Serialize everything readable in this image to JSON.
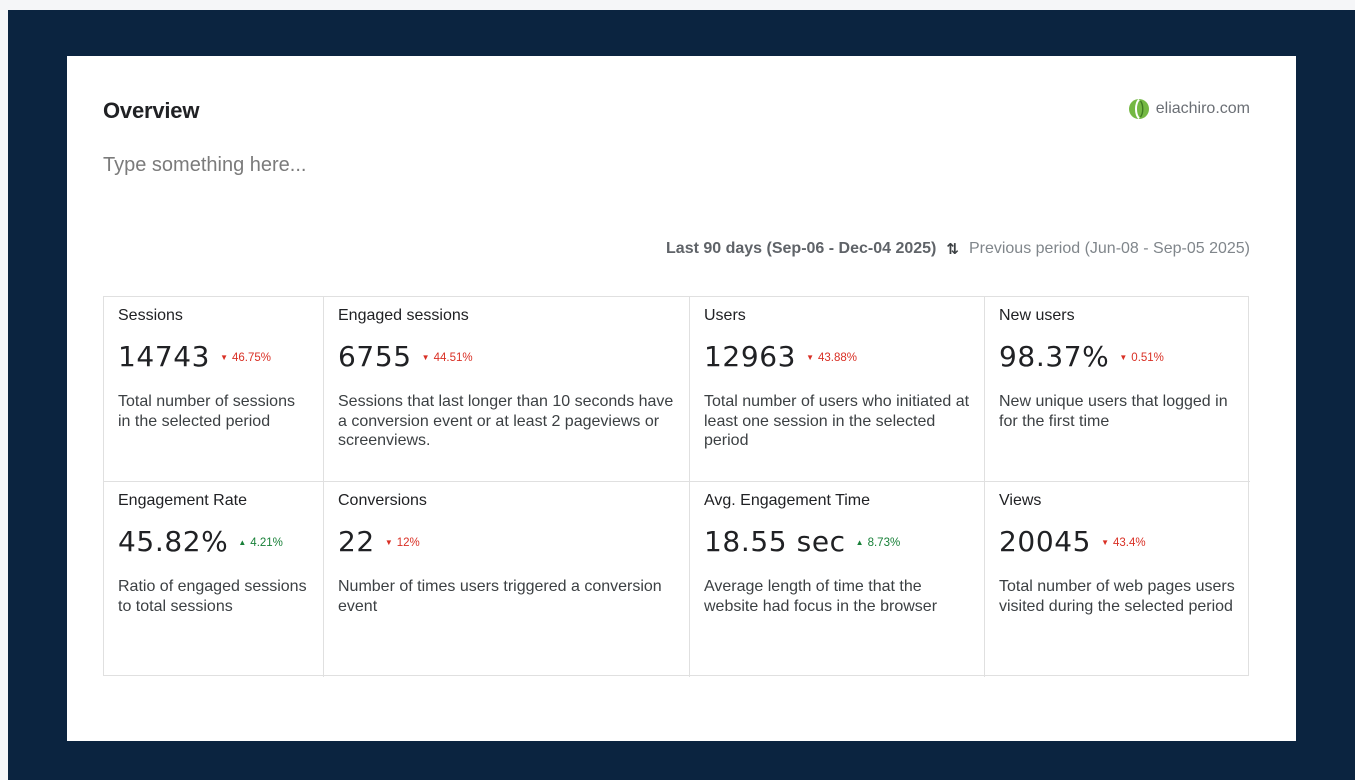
{
  "report": {
    "title": "Overview",
    "brand": "eliachiro.com",
    "description_placeholder": "Type something here...",
    "period_current": "Last 90 days (Sep-06 - Dec-04 2025)",
    "period_compare": "Previous period (Jun-08 - Sep-05 2025)"
  },
  "colors": {
    "frame": "#0b2440",
    "card": "#ffffff",
    "negative": "#d93025",
    "positive": "#188038",
    "logo_green": "#74b843"
  },
  "icons": {
    "brand": "leaf-logo-icon",
    "swap": "swap-arrows-icon",
    "down": "triangle-down-icon",
    "up": "triangle-up-icon"
  },
  "metrics": [
    {
      "name": "Sessions",
      "value": "14743",
      "change": "46.75%",
      "direction": "down",
      "description": "Total number of sessions in the selected period"
    },
    {
      "name": "Engaged sessions",
      "value": "6755",
      "change": "44.51%",
      "direction": "down",
      "description": "Sessions that last longer than 10 seconds have a conversion event or at least 2 pageviews or screenviews."
    },
    {
      "name": "Users",
      "value": "12963",
      "change": "43.88%",
      "direction": "down",
      "description": "Total number of users who initiated at least one session in the selected period"
    },
    {
      "name": "New users",
      "value": "98.37%",
      "change": "0.51%",
      "direction": "down",
      "description": "New unique users that logged in for the first time"
    },
    {
      "name": "Engagement Rate",
      "value": "45.82%",
      "change": "4.21%",
      "direction": "up",
      "description": "Ratio of engaged sessions to total sessions"
    },
    {
      "name": "Conversions",
      "value": "22",
      "change": "12%",
      "direction": "down",
      "description": "Number of times users triggered a conversion event"
    },
    {
      "name": "Avg. Engagement Time",
      "value": "18.55 sec",
      "change": "8.73%",
      "direction": "up",
      "description": "Average length of time that the website had focus in the browser"
    },
    {
      "name": "Views",
      "value": "20045",
      "change": "43.4%",
      "direction": "down",
      "description": "Total number of web pages users visited during the selected period"
    }
  ]
}
